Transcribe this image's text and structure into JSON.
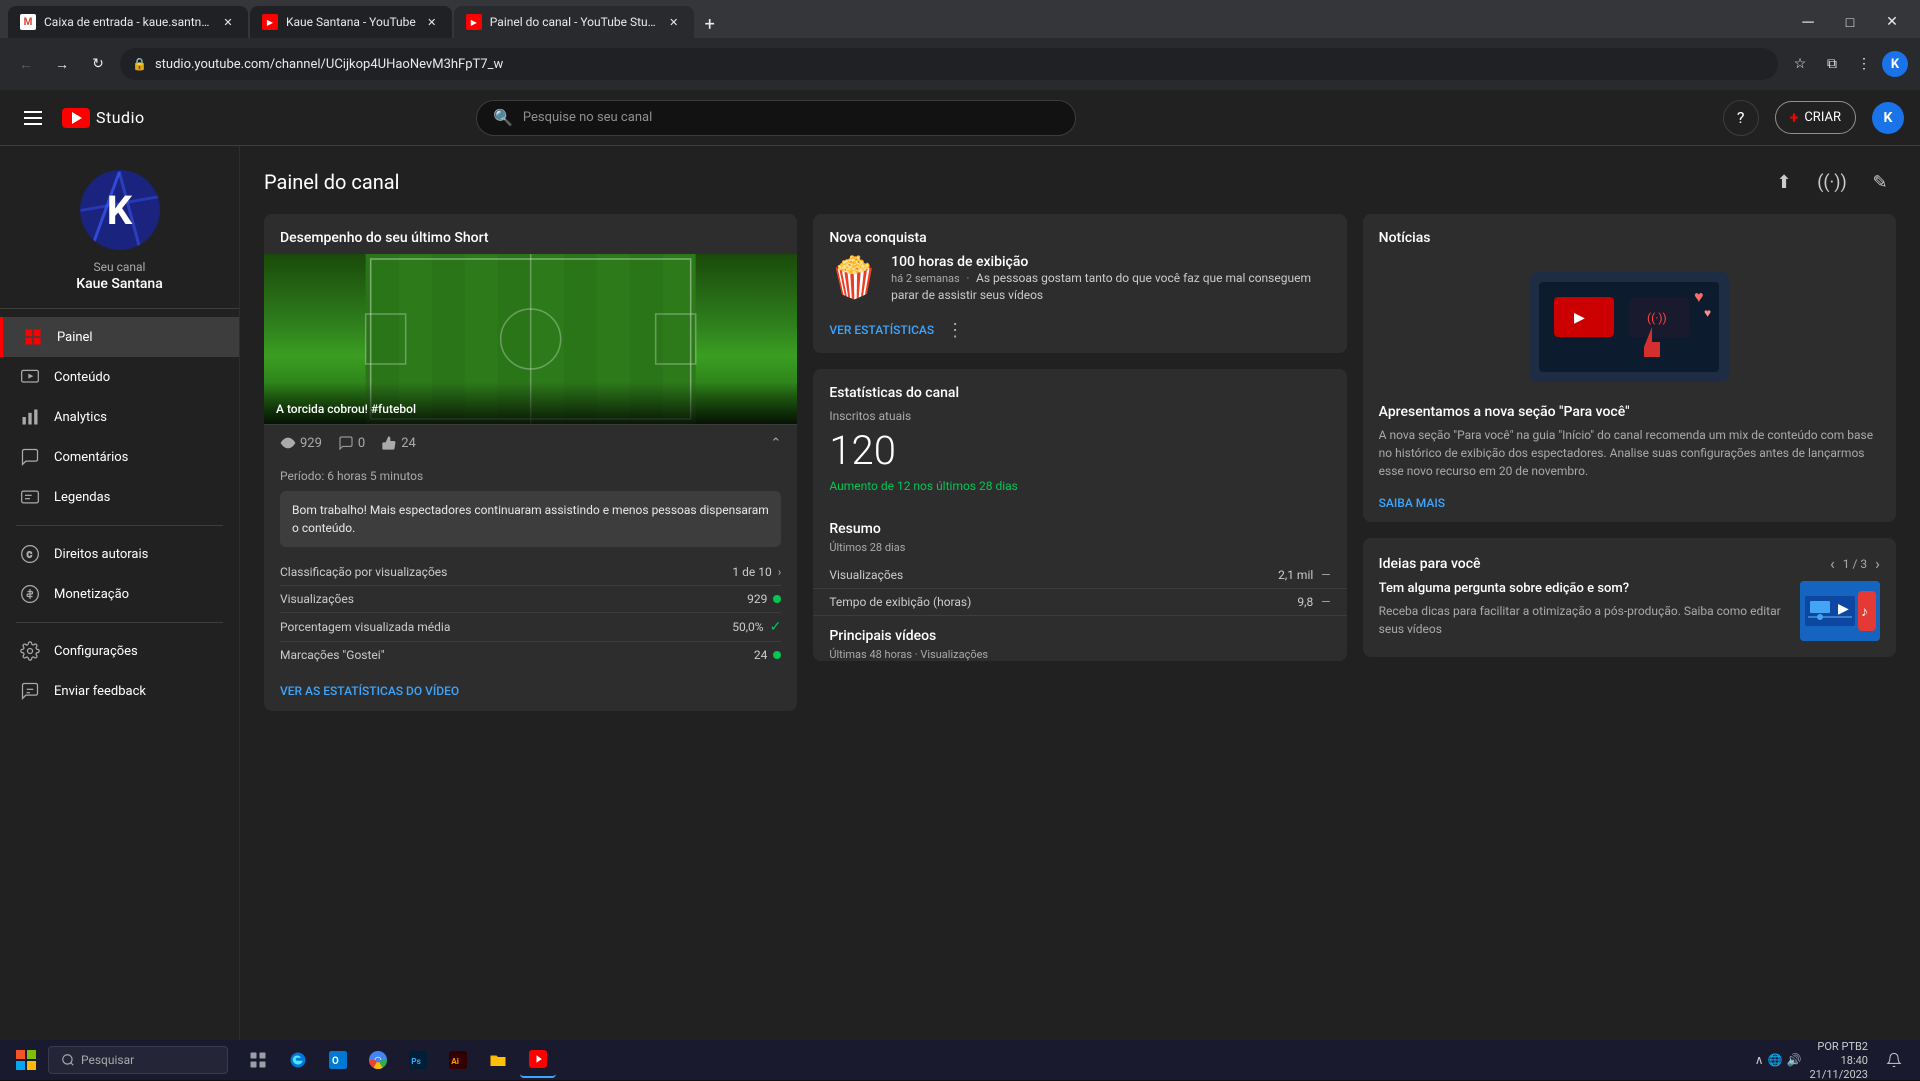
{
  "browser": {
    "tabs": [
      {
        "id": "tab-gmail",
        "title": "Caixa de entrada - kaue.santna...",
        "favicon_type": "gmail",
        "active": false
      },
      {
        "id": "tab-youtube",
        "title": "Kaue Santana - YouTube",
        "favicon_type": "yt",
        "active": false
      },
      {
        "id": "tab-studio",
        "title": "Painel do canal - YouTube Studi...",
        "favicon_type": "yts",
        "active": true
      }
    ],
    "address": "studio.youtube.com/channel/UCijkop4UHaoNevM3hFpT7_w"
  },
  "header": {
    "search_placeholder": "Pesquise no seu canal",
    "create_label": "CRIAR",
    "avatar_letter": "K"
  },
  "sidebar": {
    "channel_label": "Seu canal",
    "channel_name": "Kaue Santana",
    "nav_items": [
      {
        "id": "painel",
        "label": "Painel",
        "active": true
      },
      {
        "id": "conteudo",
        "label": "Conteúdo",
        "active": false
      },
      {
        "id": "analytics",
        "label": "Analytics",
        "active": false
      },
      {
        "id": "comentarios",
        "label": "Comentários",
        "active": false
      },
      {
        "id": "legendas",
        "label": "Legendas",
        "active": false
      },
      {
        "id": "direitos",
        "label": "Direitos autorais",
        "active": false
      },
      {
        "id": "monetizacao",
        "label": "Monetização",
        "active": false
      },
      {
        "id": "configuracoes",
        "label": "Configurações",
        "active": false
      },
      {
        "id": "feedback",
        "label": "Enviar feedback",
        "active": false
      }
    ]
  },
  "page": {
    "title": "Painel do canal"
  },
  "short_card": {
    "header": "Desempenho do seu último Short",
    "title": "A torcida cobrou! #futebol",
    "views": "929",
    "comments": "0",
    "likes": "24",
    "period": "Período: 6 horas 5 minutos",
    "feedback": "Bom trabalho! Mais espectadores continuaram assistindo e menos pessoas dispensaram o conteúdo.",
    "stats": [
      {
        "label": "Classificação por visualizações",
        "value": "1 de 10",
        "badge": "arrow"
      },
      {
        "label": "Visualizações",
        "value": "929",
        "badge": "green"
      },
      {
        "label": "Porcentagem visualizada média",
        "value": "50,0%",
        "badge": "check"
      },
      {
        "label": "Marcações \"Gostei\"",
        "value": "24",
        "badge": "green"
      }
    ],
    "stats_link": "VER AS ESTATÍSTICAS DO VÍDEO"
  },
  "achievement_card": {
    "header": "Nova conquista",
    "icon": "🍿",
    "title": "100 horas de exibição",
    "time": "há 2 semanas",
    "description": "As pessoas gostam tanto do que você faz que mal conseguem parar de assistir seus vídeos",
    "link": "VER ESTATÍSTICAS"
  },
  "channel_stats": {
    "header": "Estatísticas do canal",
    "subscribers_label": "Inscritos atuais",
    "subscribers_count": "120",
    "subscribers_growth": "Aumento de 12 nos últimos 28 dias",
    "summary_title": "Resumo",
    "summary_subtitle": "Últimos 28 dias",
    "rows": [
      {
        "label": "Visualizações",
        "value": "2,1 mil",
        "has_dash": true
      },
      {
        "label": "Tempo de exibição (horas)",
        "value": "9,8",
        "has_dash": true
      }
    ],
    "top_videos_title": "Principais vídeos",
    "top_videos_subtitle": "Últimas 48 horas · Visualizações"
  },
  "news_card": {
    "header": "Notícias",
    "title": "Apresentamos a nova seção \"Para você\"",
    "description": "A nova seção \"Para você\" na guia \"Início\" do canal recomenda um mix de conteúdo com base no histórico de exibição dos espectadores. Analise suas configurações antes de lançarmos esse novo recurso em 20 de novembro.",
    "link": "SAIBA MAIS"
  },
  "ideas_card": {
    "header": "Ideias para você",
    "nav": "1 / 3",
    "title": "Tem alguma pergunta sobre edição e som?",
    "description": "Receba dicas para facilitar a otimização a pós-produção. Saiba como editar seus vídeos"
  },
  "taskbar": {
    "search_placeholder": "Pesquisar",
    "time": "18:40",
    "date": "21/11/2023",
    "locale": "POR",
    "locale2": "PTB2"
  }
}
